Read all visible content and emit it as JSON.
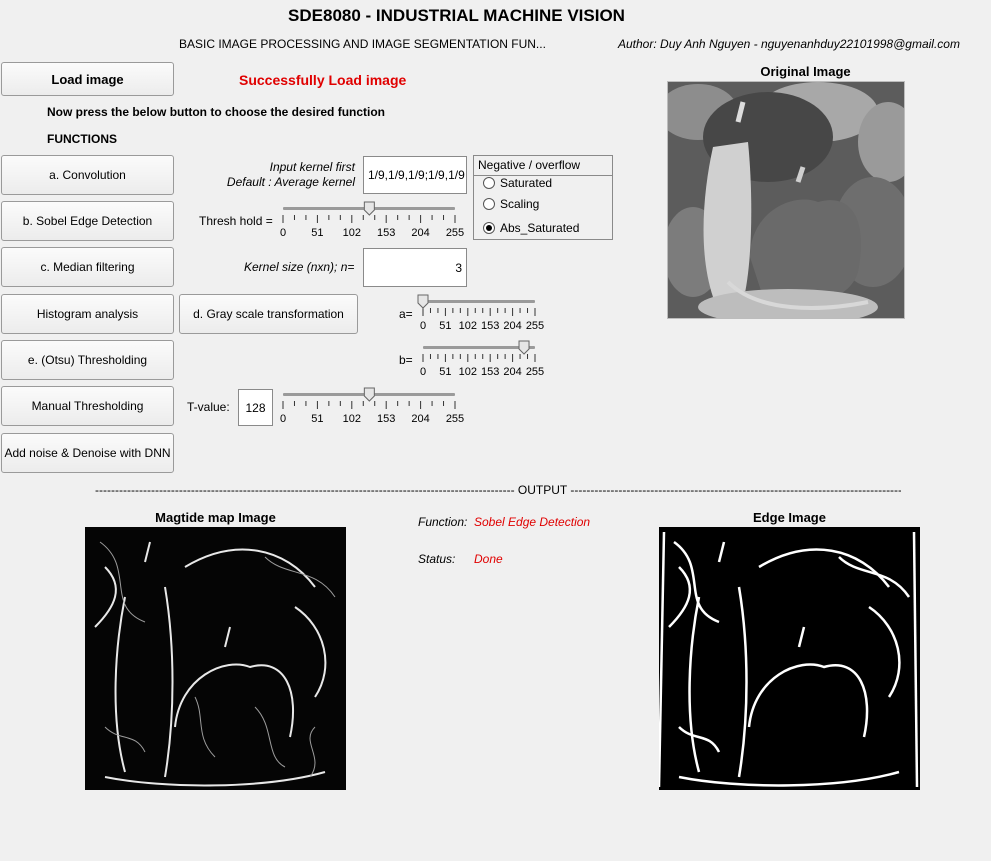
{
  "header": {
    "title": "SDE8080 - INDUSTRIAL MACHINE VISION",
    "subtitle": "BASIC IMAGE PROCESSING AND IMAGE SEGMENTATION FUN...",
    "author": "Author: Duy Anh Nguyen - nguyenanhduy22101998@gmail.com"
  },
  "load": {
    "button_label": "Load image",
    "status_message": "Successfully Load image"
  },
  "instructions": "Now press the below button to choose the desired function",
  "functions_heading": "FUNCTIONS",
  "buttons": {
    "convolution": "a. Convolution",
    "sobel": "b. Sobel Edge Detection",
    "median": "c. Median filtering",
    "histogram": "Histogram analysis",
    "gray_transform": "d. Gray scale transformation",
    "otsu": "e. (Otsu) Thresholding",
    "manual": "Manual Thresholding",
    "denoise": "Add noise & Denoise with DNN"
  },
  "convolution": {
    "label_line1": "Input kernel first",
    "label_line2": "Default : Average kernel",
    "kernel_value": "1/9,1/9,1/9;1/9,1/9"
  },
  "overflow_panel": {
    "title": "Negative / overflow",
    "options": [
      "Saturated",
      "Scaling",
      "Abs_Saturated"
    ],
    "selected": "Abs_Saturated"
  },
  "sobel": {
    "label": "Thresh hold =",
    "slider_value": 128,
    "ticks": [
      "0",
      "51",
      "102",
      "153",
      "204",
      "255"
    ]
  },
  "median": {
    "label": "Kernel size (nxn); n=",
    "value": "3"
  },
  "gray": {
    "a_label": "a=",
    "a_value": 0,
    "b_label": "b=",
    "b_value": 230,
    "ticks": [
      "0",
      "51",
      "102",
      "153",
      "204",
      "255"
    ]
  },
  "manual": {
    "label": "T-value:",
    "value": "128",
    "slider_value": 128,
    "ticks": [
      "0",
      "51",
      "102",
      "153",
      "204",
      "255"
    ]
  },
  "original": {
    "title": "Original Image"
  },
  "output": {
    "divider": "--------------------------------------------------------------------------------------------------------- OUTPUT -----------------------------------------------------------------------------------------------------------",
    "magnitude_title": "Magtide map Image",
    "edge_title": "Edge Image",
    "function_label": "Function:",
    "function_value": "Sobel Edge Detection",
    "status_label": "Status:",
    "status_value": "Done"
  },
  "colors": {
    "accent_red": "#e00000",
    "background": "#f0f0f0"
  }
}
